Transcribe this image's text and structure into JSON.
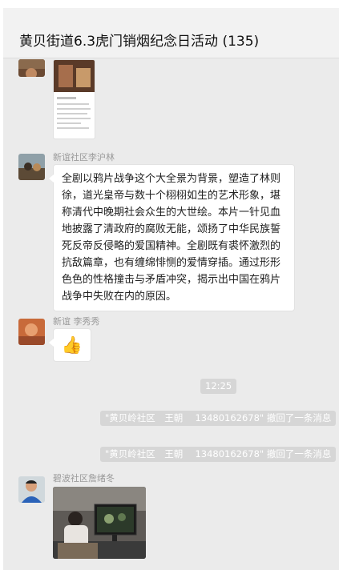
{
  "header": {
    "title": "黄贝街道6.3虎门销烟纪念日活动 (135)"
  },
  "messages": [
    {
      "type": "image",
      "avatar_icon": "avatar-photo-icon"
    },
    {
      "type": "text",
      "sender": "新谊社区李沪林",
      "text": "全剧以鸦片战争这个大全景为背景，塑造了林则徐，道光皇帝与数十个栩栩如生的艺术形象，堪称清代中晚期社会众生的大世绘。本片一针见血地披露了清政府的腐败无能，颂扬了中华民族誓死反帝反侵略的爱国精神。全剧既有裘怀激烈的抗敌篇章，也有缠绵悱恻的爱情穿插。通过形形色色的性格撞击与矛盾冲突，揭示出中国在鸦片战争中失败在内的原因。"
    },
    {
      "type": "emoji",
      "sender": "新谊 李秀秀",
      "emoji": "👍"
    },
    {
      "type": "time",
      "text": "12:25"
    },
    {
      "type": "system",
      "text": "\"黄贝岭社区　王朝　 13480162678\" 撤回了一条消息"
    },
    {
      "type": "system",
      "text": "\"黄贝岭社区　王朝　 13480162678\" 撤回了一条消息"
    },
    {
      "type": "image",
      "sender": "碧波社区詹绪冬",
      "avatar_icon": "avatar-man-icon"
    }
  ],
  "colors": {
    "background": "#ebebeb",
    "bubble": "#ffffff",
    "system_pill": "#d6d6d6"
  }
}
